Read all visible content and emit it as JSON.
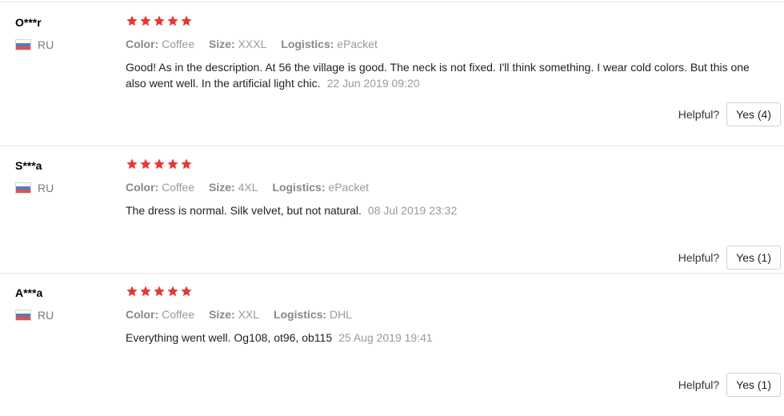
{
  "colors": {
    "star": "#e53935",
    "divider": "#e6e6e6",
    "muted": "#9a9a9a"
  },
  "reviews": [
    {
      "user": "O***r",
      "country": "RU",
      "rating": 5,
      "color_label": "Color:",
      "color_value": "Coffee",
      "size_label": "Size:",
      "size_value": "XXXL",
      "logistics_label": "Logistics:",
      "logistics_value": "ePacket",
      "text": "Good! As in the description. At 56 the village is good. The neck is not fixed. I'll think something. I wear cold colors. But this one also went well. In the artificial light chic.",
      "date": "22 Jun 2019 09:20",
      "helpful_label": "Helpful?",
      "yes_label": "Yes (4)"
    },
    {
      "user": "S***a",
      "country": "RU",
      "rating": 5,
      "color_label": "Color:",
      "color_value": "Coffee",
      "size_label": "Size:",
      "size_value": "4XL",
      "logistics_label": "Logistics:",
      "logistics_value": "ePacket",
      "text": "The dress is normal. Silk velvet, but not natural.",
      "date": "08 Jul 2019 23:32",
      "helpful_label": "Helpful?",
      "yes_label": "Yes (1)"
    },
    {
      "user": "A***a",
      "country": "RU",
      "rating": 5,
      "color_label": "Color:",
      "color_value": "Coffee",
      "size_label": "Size:",
      "size_value": "XXL",
      "logistics_label": "Logistics:",
      "logistics_value": "DHL",
      "text": "Everything went well. Og108, ot96, ob115",
      "date": "25 Aug 2019 19:41",
      "helpful_label": "Helpful?",
      "yes_label": "Yes (1)"
    }
  ]
}
